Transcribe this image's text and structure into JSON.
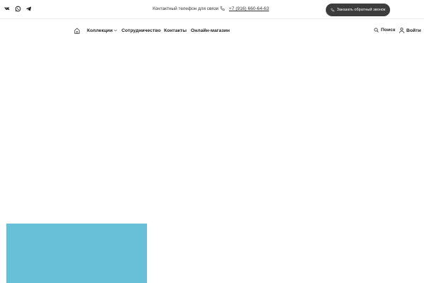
{
  "topbar": {
    "socials": [
      {
        "icon": "vk-icon",
        "label": "vk"
      },
      {
        "icon": "whatsapp-icon",
        "label": "WhatsApp"
      },
      {
        "icon": "telegram-icon",
        "label": "Telegram"
      }
    ],
    "contact_label": "Контактный телефон для связи",
    "phone_icon": "phone-icon",
    "phone": "+7 (916) 660-64-63",
    "callback_button": "Заказать обратный звонок"
  },
  "nav": {
    "home_icon": "home-icon",
    "items": [
      {
        "label": "Коллекции",
        "has_dropdown": true
      },
      {
        "label": "Сотрудничество"
      },
      {
        "label": "Контакты"
      },
      {
        "label": "Онлайн-магазин"
      }
    ],
    "search_label": "Поиск",
    "login_label": "Войти"
  },
  "colors": {
    "accent_block": "#68bfd8",
    "button_bg": "#3c3c3c",
    "text": "#222222"
  }
}
